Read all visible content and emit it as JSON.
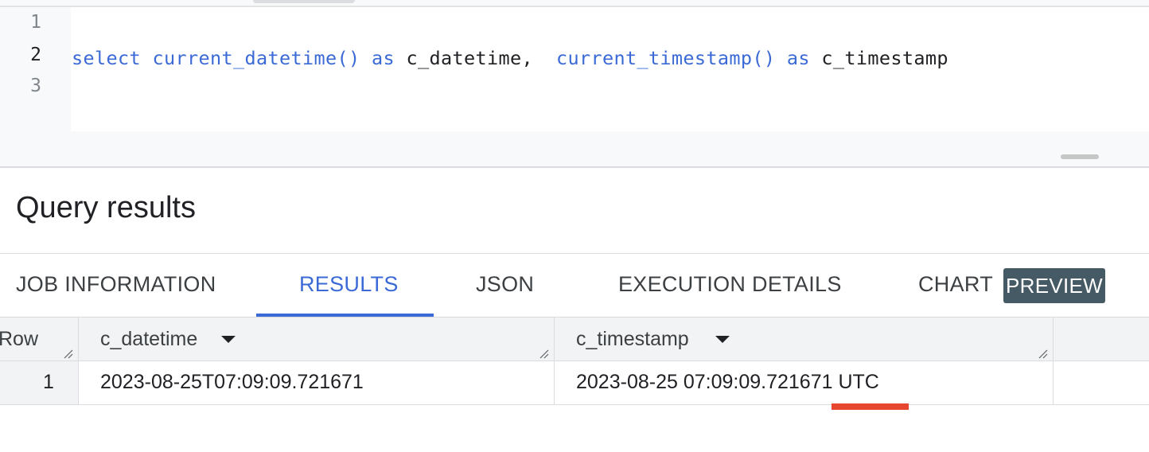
{
  "editor": {
    "line_numbers": [
      "1",
      "2",
      "3"
    ],
    "code": {
      "kw_select": "select",
      "fn_datetime": "current_datetime()",
      "kw_as_1": "as",
      "alias_1": "c_datetime,",
      "fn_timestamp": "current_timestamp()",
      "kw_as_2": "as",
      "alias_2": "c_timestamp"
    }
  },
  "results": {
    "title": "Query results",
    "tabs": [
      {
        "label": "JOB INFORMATION"
      },
      {
        "label": "RESULTS",
        "active": true
      },
      {
        "label": "JSON"
      },
      {
        "label": "EXECUTION DETAILS"
      },
      {
        "label": "CHART"
      }
    ],
    "preview_badge": "PREVIEW",
    "table": {
      "columns": [
        "Row",
        "c_datetime",
        "c_timestamp"
      ],
      "rows": [
        [
          "1",
          "2023-08-25T07:09:09.721671",
          "2023-08-25 07:09:09.721671 UTC"
        ]
      ]
    }
  },
  "colors": {
    "accent": "#3b6ad6",
    "highlight": "#e8472f",
    "badge": "#455a64"
  }
}
